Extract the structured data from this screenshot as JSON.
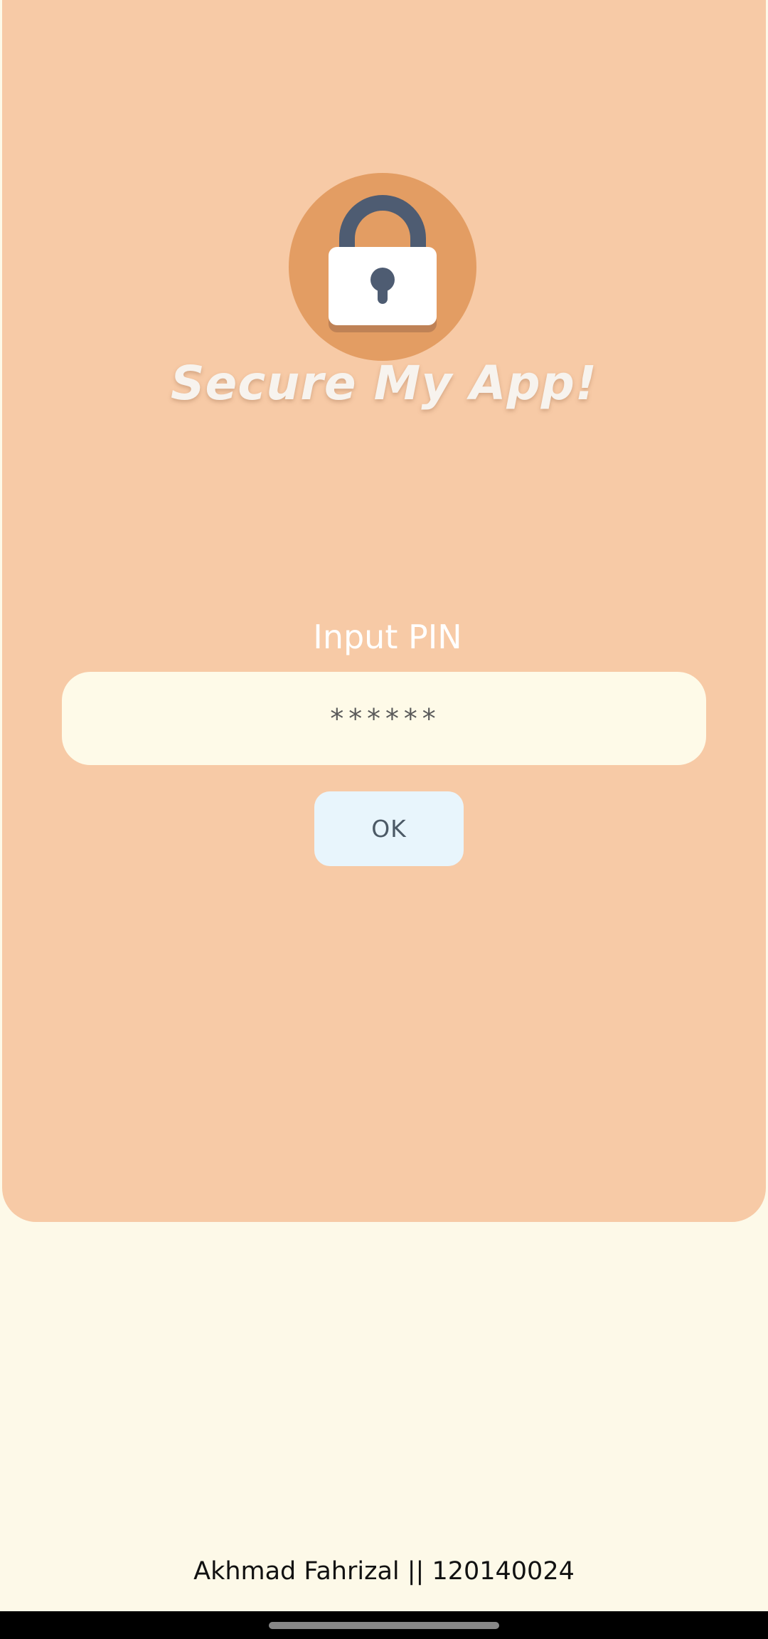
{
  "app": {
    "title": "Secure My App!",
    "logo_icon": "padlock-icon"
  },
  "pin": {
    "label": "Input PIN",
    "placeholder": "******",
    "value": ""
  },
  "actions": {
    "ok_label": "OK"
  },
  "footer": {
    "credit": "Akhmad Fahrizal || 120140024"
  },
  "colors": {
    "card_background": "#f7caa6",
    "page_background": "#fdf9e8",
    "logo_circle": "#e39d63",
    "lock_shackle": "#4e5c72",
    "button_background": "#e8f5fc"
  }
}
